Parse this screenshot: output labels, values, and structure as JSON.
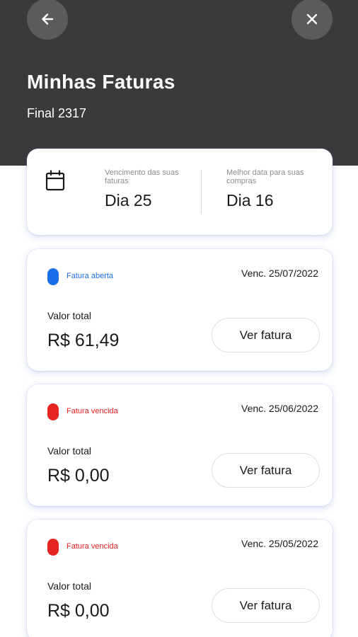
{
  "header": {
    "title": "Minhas Faturas",
    "subtitle": "Final 2317",
    "back_icon": "arrow-left-icon",
    "close_icon": "close-icon"
  },
  "summary": {
    "due_label": "Vencimento das suas faturas",
    "due_value": "Dia 25",
    "best_label": "Melhor data para suas compras",
    "best_value": "Dia 16",
    "icon": "calendar-icon"
  },
  "invoices": [
    {
      "status": "Fatura aberta",
      "status_color": "#1a6fe8",
      "due": "Venc. 25/07/2022",
      "total_label": "Valor total",
      "amount": "R$ 61,49",
      "button": "Ver fatura"
    },
    {
      "status": "Fatura vencida",
      "status_color": "#e52521",
      "due": "Venc. 25/06/2022",
      "total_label": "Valor total",
      "amount": "R$ 0,00",
      "button": "Ver fatura"
    },
    {
      "status": "Fatura vencida",
      "status_color": "#e52521",
      "due": "Venc. 25/05/2022",
      "total_label": "Valor total",
      "amount": "R$ 0,00",
      "button": "Ver fatura"
    }
  ],
  "colors": {
    "header_bg": "#3a3a3a",
    "circle_button_bg": "#5b5b5b",
    "card_shadow": "#6a7be0"
  }
}
